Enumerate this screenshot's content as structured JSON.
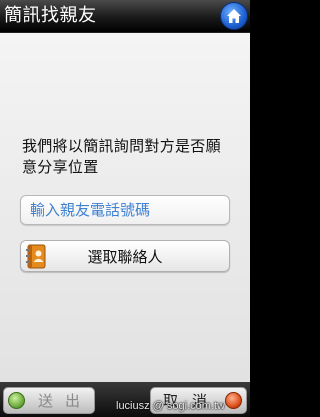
{
  "header": {
    "title": "簡訊找親友",
    "home_icon": "home-icon"
  },
  "main": {
    "message": "我們將以簡訊詢問對方是否願意分享位置",
    "phone_input": {
      "placeholder": "輸入親友電話號碼"
    },
    "contacts_button": {
      "label": "選取聯絡人",
      "icon": "address-book-icon"
    }
  },
  "footer": {
    "send_label": "送出",
    "cancel_label": "取消",
    "watermark": "luciusz @ sogi.com.tw"
  },
  "colors": {
    "title_bar": "#1a1a1a",
    "home_button": "#1d5fd0",
    "placeholder_text": "#3f82d4",
    "content_bg": "#ececec",
    "send_icon": "#6aa63b",
    "cancel_icon": "#d84a16"
  }
}
